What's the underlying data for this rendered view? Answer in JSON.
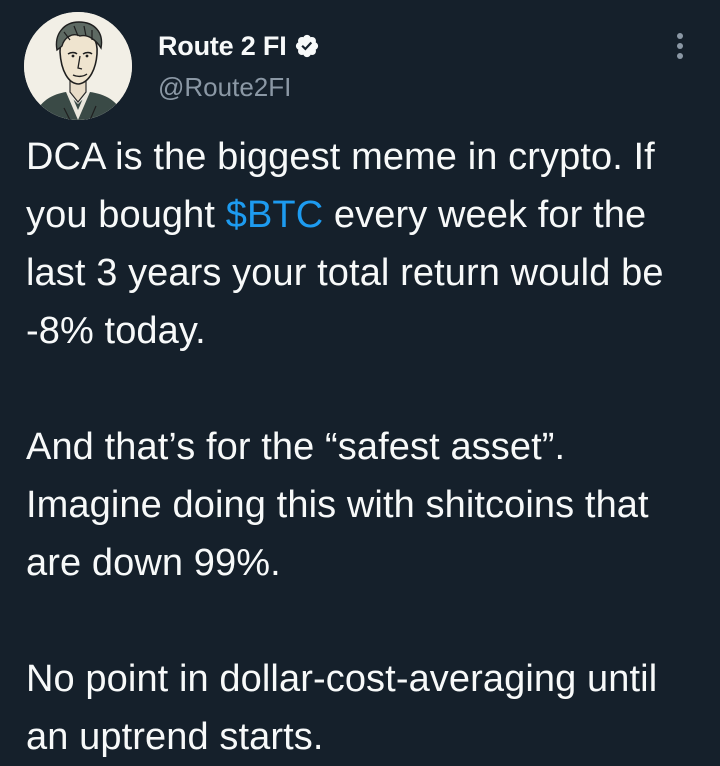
{
  "author": {
    "display_name": "Route 2 FI",
    "handle": "@Route2FI",
    "verified": true,
    "avatar": "sketched-portrait-avatar"
  },
  "tweet": {
    "paragraph1": {
      "before": "DCA is the biggest meme in crypto. If you bought ",
      "cashtag": "$BTC",
      "after": " every week for the last 3 years your total return would be -8% today."
    },
    "paragraph2": "And that’s for the “safest asset”. Imagine doing this with shitcoins that are down 99%.",
    "paragraph3": "No point in dollar-cost-averaging until an uptrend starts."
  },
  "icons": {
    "verified": "verified-badge-icon",
    "more": "more-options-icon"
  },
  "colors": {
    "background": "#15202b",
    "text": "#f7f9f9",
    "secondary_text": "#8b98a5",
    "link": "#1d9bf0"
  }
}
